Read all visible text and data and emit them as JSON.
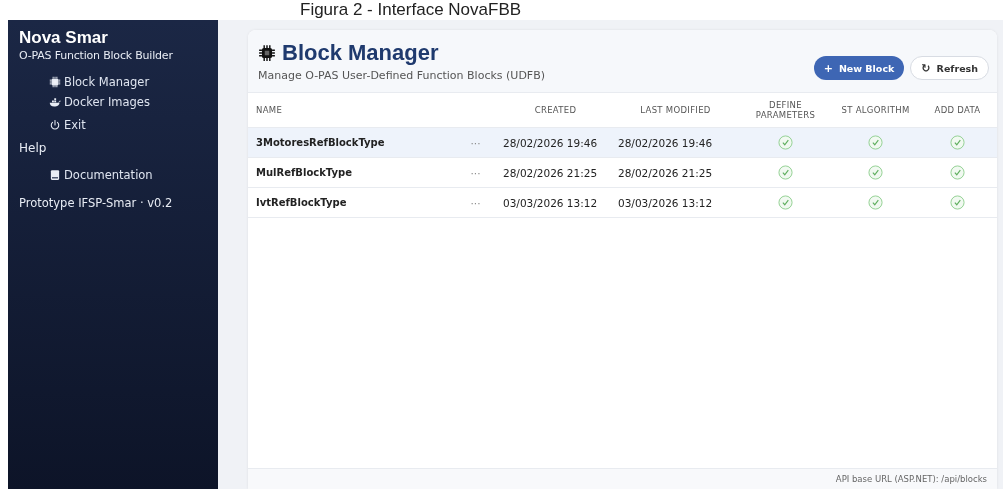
{
  "caption": "Figura 2 - Interface NovaFBB",
  "sidebar": {
    "title": "Nova Smar",
    "subtitle": "O-PAS Function Block Builder",
    "items": [
      {
        "label": "Block Manager",
        "kind": "chip",
        "selected": false
      },
      {
        "label": "Docker Images",
        "kind": "whale",
        "selected": false
      },
      {
        "label": "Exit",
        "kind": "power",
        "selected": false
      }
    ],
    "sections": [
      {
        "heading": "Help",
        "items": [
          {
            "label": "Documentation",
            "kind": "book",
            "selected": false
          }
        ]
      }
    ],
    "version": "Prototype IFSP-Smar · v0.2"
  },
  "page": {
    "title": "Block Manager",
    "subtitle": "Manage O-PAS User-Defined Function Blocks (UDFB)",
    "buttons": [
      {
        "label": "New Block",
        "icon": "+",
        "kind": "primary"
      },
      {
        "label": "Refresh",
        "icon": "↻",
        "kind": "secondary"
      }
    ]
  },
  "table": {
    "columns": [
      "NAME",
      "CREATED",
      "LAST MODIFIED",
      "DEFINE PARAMETERS",
      "ST ALGORITHM",
      "ADD DATA"
    ],
    "rows": [
      {
        "name": "3MotoresRefBlockType",
        "menu": "···",
        "created": "28/02/2026 19:46",
        "last_modified": "28/02/2026 19:46",
        "define_parameters": true,
        "st_algorithm": true,
        "add_data": true,
        "selected": true
      },
      {
        "name": "MulRefBlockType",
        "menu": "···",
        "created": "28/02/2026 21:25",
        "last_modified": "28/02/2026 21:25",
        "define_parameters": true,
        "st_algorithm": true,
        "add_data": true,
        "selected": false
      },
      {
        "name": "IvtRefBlockType",
        "menu": "···",
        "created": "03/03/2026 13:12",
        "last_modified": "03/03/2026 13:12",
        "define_parameters": true,
        "st_algorithm": true,
        "add_data": true,
        "selected": false
      }
    ]
  },
  "status_bar": "API base URL (ASP.NET): /api/blocks"
}
